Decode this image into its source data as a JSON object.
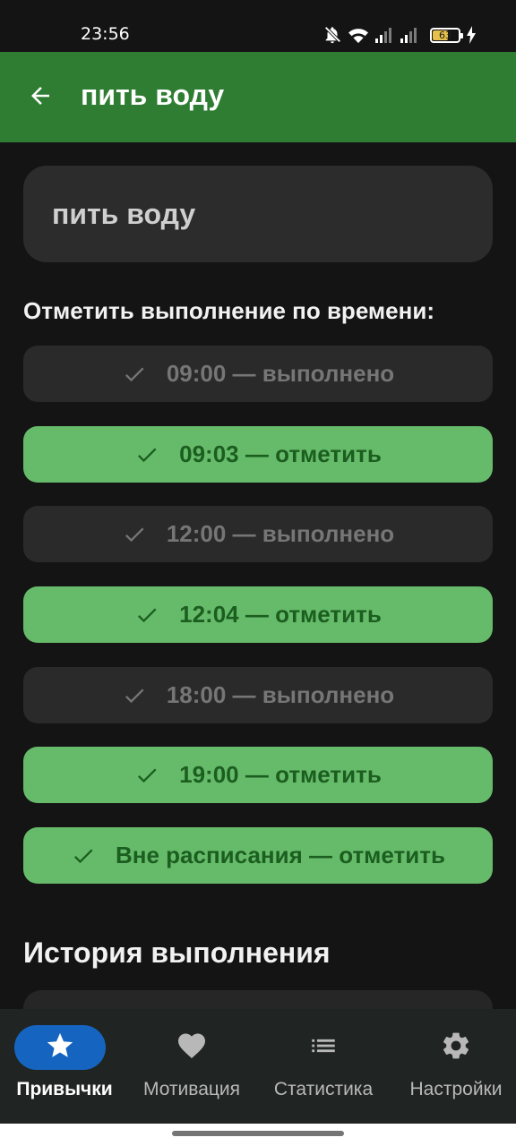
{
  "status_bar": {
    "time": "23:56",
    "battery_level": 63,
    "battery_label": "63",
    "icons": [
      "bell-muted-icon",
      "wifi-icon",
      "signal-icon",
      "signal-icon",
      "battery-icon",
      "charging-icon"
    ]
  },
  "app_bar": {
    "back_icon": "arrow-back-icon",
    "title": "пить воду"
  },
  "habit": {
    "name": "пить воду"
  },
  "schedule": {
    "label": "Отметить выполнение по времени:",
    "items": [
      {
        "text": "09:00 — выполнено",
        "state": "done"
      },
      {
        "text": "09:03 — отметить",
        "state": "pending"
      },
      {
        "text": "12:00 — выполнено",
        "state": "done"
      },
      {
        "text": "12:04 — отметить",
        "state": "pending"
      },
      {
        "text": "18:00 — выполнено",
        "state": "done"
      },
      {
        "text": "19:00 — отметить",
        "state": "pending"
      },
      {
        "text": "Вне расписания — отметить",
        "state": "pending"
      }
    ]
  },
  "history": {
    "title": "История выполнения"
  },
  "bottom_nav": {
    "items": [
      {
        "label": "Привычки",
        "icon": "star-icon",
        "active": true
      },
      {
        "label": "Мотивация",
        "icon": "heart-icon",
        "active": false
      },
      {
        "label": "Статистика",
        "icon": "list-icon",
        "active": false
      },
      {
        "label": "Настройки",
        "icon": "gear-icon",
        "active": false
      }
    ]
  },
  "colors": {
    "app_bar": "#2e7d32",
    "background": "#141414",
    "card": "#2c2c2c",
    "pending_button": "#66bb6a",
    "pending_text": "#1b5e20",
    "done_button": "#2a2a2a",
    "done_text": "#767676",
    "nav_active": "#1565c0",
    "battery": "#e5c04a"
  }
}
